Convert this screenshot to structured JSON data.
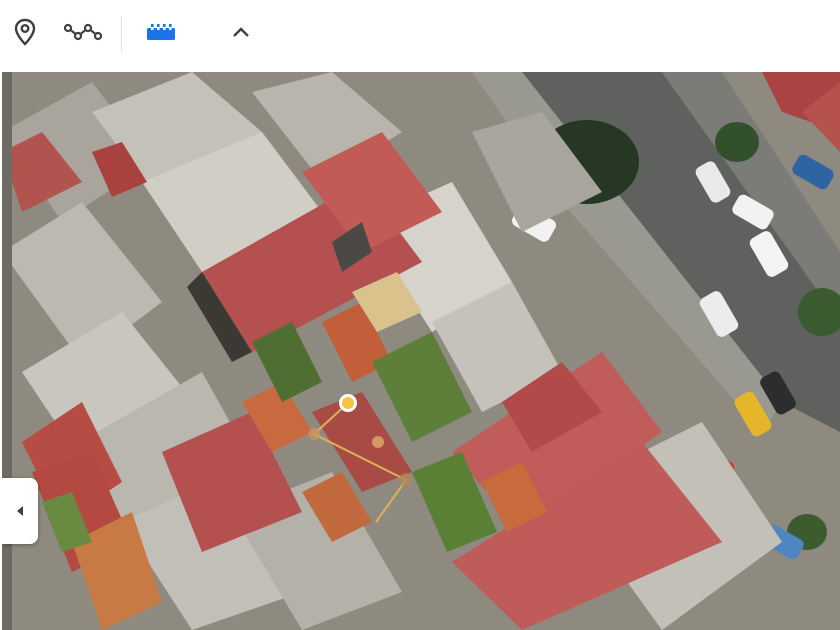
{
  "toolbar": {
    "tools": [
      {
        "name": "placemark-tool",
        "icon": "map-pin-icon",
        "active": false
      },
      {
        "name": "path-tool",
        "icon": "path-nodes-icon",
        "active": false
      },
      {
        "name": "measure-tool",
        "icon": "ruler-icon",
        "active": true
      },
      {
        "name": "collapse-toolbar",
        "icon": "chevron-up-icon",
        "active": false
      }
    ]
  },
  "map": {
    "type": "satellite",
    "measurement": {
      "point_count": 4
    },
    "side_panel_toggle_icon": "chevron-left-icon"
  },
  "colors": {
    "accent_blue": "#1a73e8",
    "icon_gray": "#3c4043",
    "measure_line": "#f4c542",
    "roof_red": "#b4504f",
    "roof_orange": "#c9693f",
    "concrete": "#bdbab2",
    "street": "#5f615e",
    "grass": "#5d7f3a"
  }
}
